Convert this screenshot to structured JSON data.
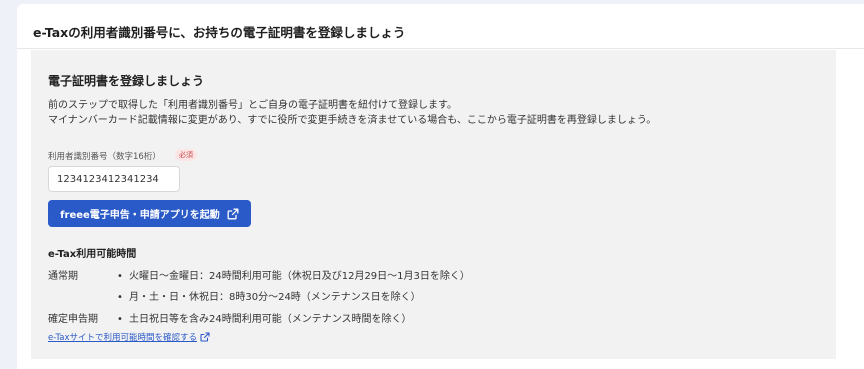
{
  "card": {
    "title": "e-Taxの利用者識別番号に、お持ちの電子証明書を登録しましょう"
  },
  "section": {
    "title": "電子証明書を登録しましょう",
    "description_line1": "前のステップで取得した「利用者識別番号」とご自身の電子証明書を紐付けて登録します。",
    "description_line2": "マイナンバーカード記載情報に変更があり、すでに役所で変更手続きを済ませている場合も、ここから電子証明書を再登録しましょう。"
  },
  "id_field": {
    "label": "利用者識別番号（数字16桁）",
    "required_badge": "必須",
    "value": "1234123412341234"
  },
  "launch_button": {
    "label": "freee電子申告・申請アプリを起動",
    "icon": "external-link-icon"
  },
  "hours": {
    "title": "e-Tax利用可能時間",
    "regular_label": "通常期",
    "regular_items": [
      "火曜日～金曜日：24時間利用可能（休祝日及び12月29日～1月3日を除く）",
      "月・土・日・休祝日：8時30分～24時（メンテナンス日を除く）"
    ],
    "filing_label": "確定申告期",
    "filing_items": [
      "土日祝日等を含み24時間利用可能（メンテナンス時間を除く）"
    ],
    "bullet": "•",
    "link_label": "e-Taxサイトで利用可能時間を確認する",
    "link_icon": "external-link-icon"
  },
  "colors": {
    "page_background": "#eef2f8",
    "panel_background": "#f3f2f2",
    "primary": "#2a59c8",
    "required_badge_text": "#c94a4a",
    "required_badge_background": "#fde5e5"
  }
}
